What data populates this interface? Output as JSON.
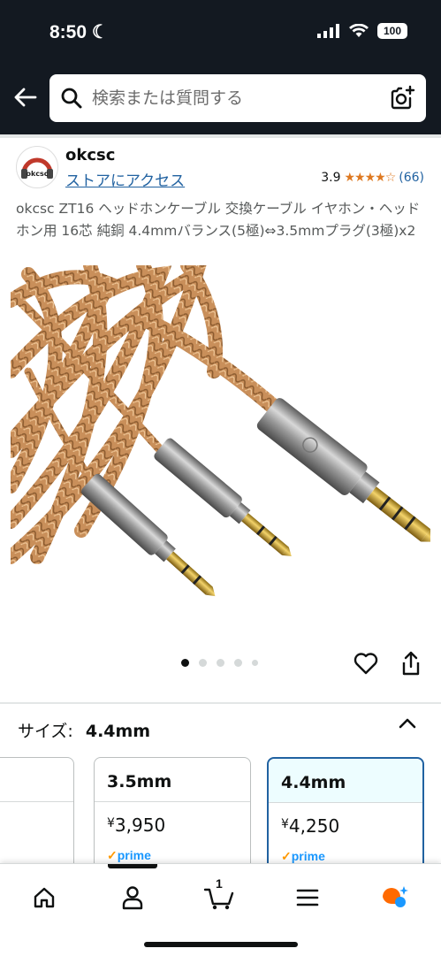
{
  "status_bar": {
    "time": "8:50",
    "battery": "100"
  },
  "search": {
    "placeholder": "検索または質問する"
  },
  "brand": {
    "name": "okcsc",
    "logo_text": "okcsc",
    "store_link": "ストアにアクセス",
    "rating": "3.9",
    "stars": "★★★★☆",
    "rating_count": "(66)"
  },
  "product": {
    "title": "okcsc ZT16 ヘッドホンケーブル 交換ケーブル イヤホン・ヘッドホン用 16芯 純銅 4.4mmバランス(5極)⇔3.5mmプラグ(3極)x2"
  },
  "carousel": {
    "total_dots": 5,
    "active_index": 0
  },
  "size": {
    "label": "サイズ:",
    "value": "4.4mm",
    "options": [
      {
        "name": "3.5mm",
        "price": "3,950",
        "currency": "¥",
        "prime": "prime"
      },
      {
        "name": "4.4mm",
        "price": "4,250",
        "currency": "¥",
        "prime": "prime",
        "selected": true
      }
    ]
  },
  "nav": {
    "cart_count": "1"
  },
  "colors": {
    "header_bg": "#131921",
    "link": "#2162a1",
    "star": "#de7921",
    "selected_border": "#2162a1",
    "prime_blue": "#1a98ff"
  }
}
